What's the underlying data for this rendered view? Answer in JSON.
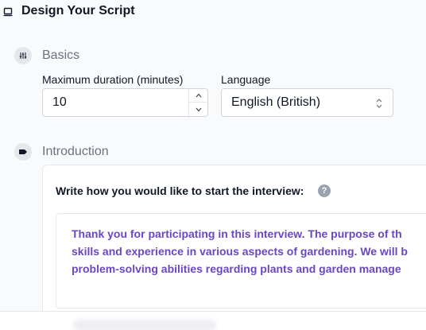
{
  "header": {
    "title": "Design Your Script",
    "icon": "script-icon"
  },
  "sections": {
    "basics": {
      "label": "Basics",
      "icon": "sliders-icon",
      "duration": {
        "label": "Maximum duration (minutes)",
        "value": "10"
      },
      "language": {
        "label": "Language",
        "value": "English (British)"
      }
    },
    "introduction": {
      "label": "Introduction",
      "icon": "tag-icon",
      "prompt": "Write how you would like to start the interview:",
      "help": "?",
      "text": "Thank you for participating in this interview. The purpose of th\nskills and experience in various aspects of gardening. We will b\nproblem-solving abilities regarding plants and garden manage"
    }
  },
  "colors": {
    "accent_text": "#6b46c1",
    "section_icon_bg": "#e5e7eb",
    "muted": "#6b7280"
  }
}
